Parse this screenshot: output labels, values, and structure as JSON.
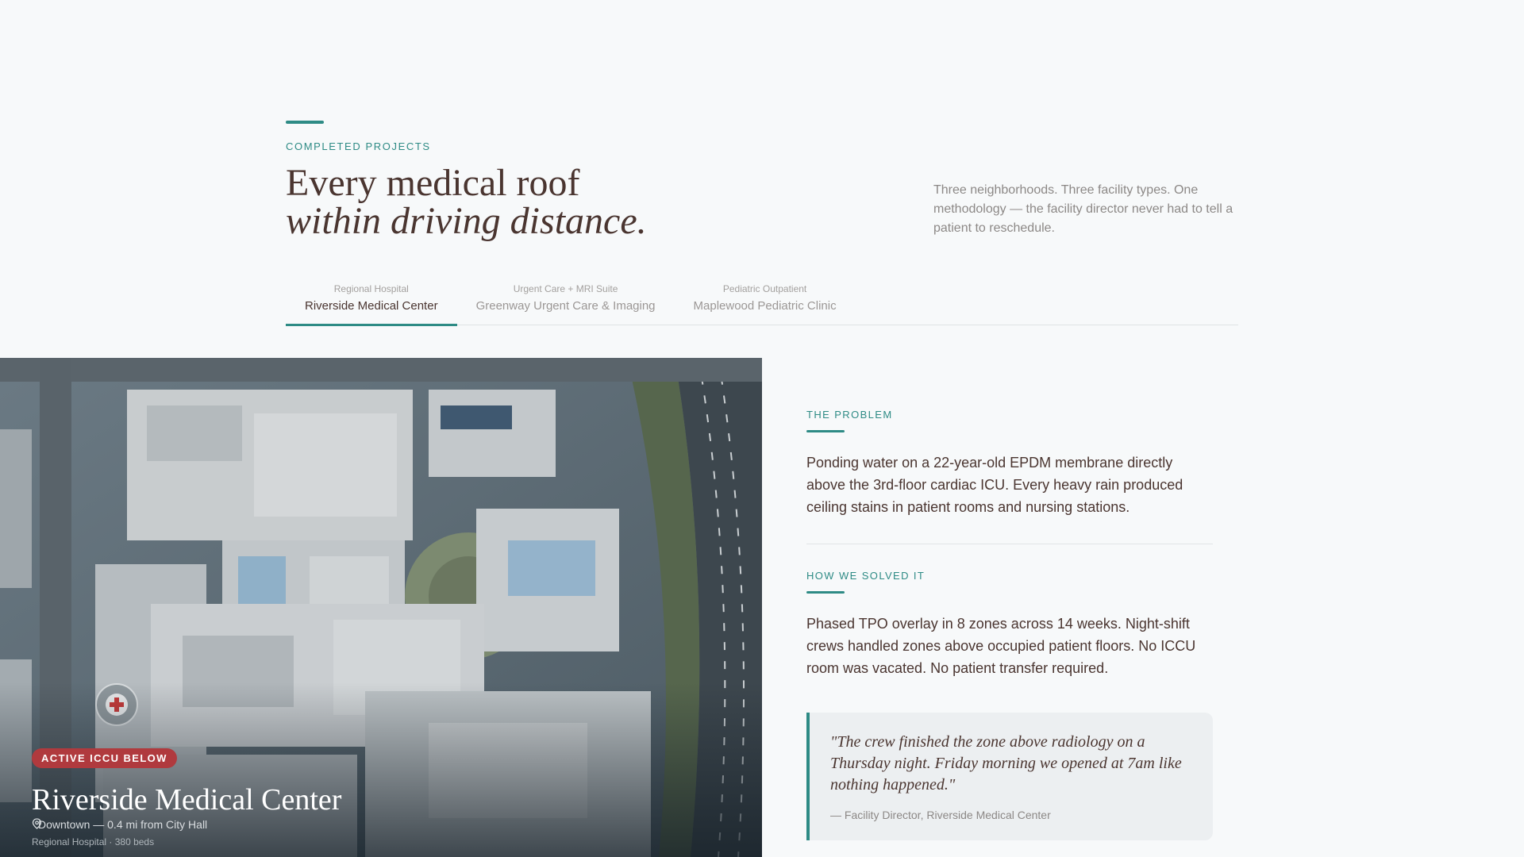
{
  "header": {
    "eyebrow": "COMPLETED PROJECTS",
    "headline_line1": "Every medical roof",
    "headline_line2": "within driving distance.",
    "intro": "Three neighborhoods. Three facility types. One methodology — the facility director never had to tell a patient to reschedule."
  },
  "tabs": [
    {
      "type": "Regional Hospital",
      "name": "Riverside Medical Center",
      "active": true
    },
    {
      "type": "Urgent Care + MRI Suite",
      "name": "Greenway Urgent Care & Imaging",
      "active": false
    },
    {
      "type": "Pediatric Outpatient",
      "name": "Maplewood Pediatric Clinic",
      "active": false
    }
  ],
  "photo": {
    "badge": "ACTIVE ICCU BELOW",
    "title": "Riverside Medical Center",
    "location": "Downtown — 0.4 mi from City Hall",
    "meta": "Regional Hospital · 380 beds",
    "location_icon": "map-pin-icon",
    "badge_color": "#b03a3e"
  },
  "problem": {
    "label": "THE PROBLEM",
    "body": "Ponding water on a 22-year-old EPDM membrane directly above the 3rd-floor cardiac ICU. Every heavy rain produced ceiling stains in patient rooms and nursing stations."
  },
  "solution": {
    "label": "HOW WE SOLVED IT",
    "body": "Phased TPO overlay in 8 zones across 14 weeks. Night-shift crews handled zones above occupied patient floors. No ICCU room was vacated. No patient transfer required."
  },
  "testimonial": {
    "quote": "\"The crew finished the zone above radiology on a Thursday night. Friday morning we opened at 7am like nothing happened.\"",
    "attribution": "— Facility Director, Riverside Medical Center"
  },
  "colors": {
    "accent": "#2e8b85",
    "text": "#4a3530",
    "muted": "#8c8886",
    "background": "#f7f9fa"
  }
}
